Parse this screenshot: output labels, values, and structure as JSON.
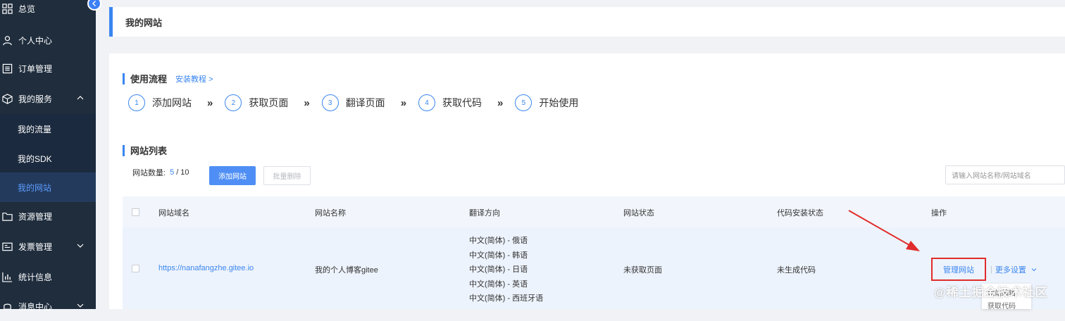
{
  "sidebar": {
    "items": [
      {
        "label": "总览",
        "icon": "grid-icon"
      },
      {
        "label": "个人中心",
        "icon": "user-icon"
      },
      {
        "label": "订单管理",
        "icon": "list-icon"
      },
      {
        "label": "我的服务",
        "icon": "box-icon"
      },
      {
        "label": "资源管理",
        "icon": "folder-icon"
      },
      {
        "label": "发票管理",
        "icon": "invoice-icon"
      },
      {
        "label": "统计信息",
        "icon": "chart-icon"
      },
      {
        "label": "消息中心",
        "icon": "bell-icon"
      }
    ],
    "subitems": [
      {
        "label": "我的流量"
      },
      {
        "label": "我的SDK"
      },
      {
        "label": "我的网站"
      }
    ],
    "active_color": "#5b9cff"
  },
  "header": {
    "title": "我的网站"
  },
  "flow": {
    "title": "使用流程",
    "tutorial_link": "安装教程 >",
    "steps": [
      {
        "num": "1",
        "label": "添加网站"
      },
      {
        "num": "2",
        "label": "获取页面"
      },
      {
        "num": "3",
        "label": "翻译页面"
      },
      {
        "num": "4",
        "label": "获取代码"
      },
      {
        "num": "5",
        "label": "开始使用"
      }
    ],
    "arrow": "»"
  },
  "sites": {
    "title": "网站列表",
    "count_label": "网站数量:",
    "count_current": "5",
    "count_total": "/ 10",
    "add_button": "添加网站",
    "batch_delete_button": "批量删除",
    "search_placeholder": "请输入网站名称/网站域名",
    "columns": [
      "网站域名",
      "网站名称",
      "翻译方向",
      "网站状态",
      "代码安装状态",
      "操作"
    ],
    "rows": [
      {
        "domain": "https://nanafangzhe.gitee.io",
        "name": "我的个人博客gitee",
        "directions": [
          "中文(简体) - 俄语",
          "中文(简体) - 韩语",
          "中文(简体) - 日语",
          "中文(简体) - 英语",
          "中文(简体) - 西班牙语"
        ],
        "status": "未获取页面",
        "code_status": "未生成代码",
        "manage_label": "管理网站",
        "more_label": "更多设置"
      }
    ],
    "dropdown_items": [
      "网站编辑",
      "获取代码"
    ]
  },
  "watermark": "@稀土掘金技术社区",
  "colors": {
    "accent": "#3a86f0",
    "sidebar_bg": "#1f2d3d",
    "highlight": "#e02c2c"
  }
}
